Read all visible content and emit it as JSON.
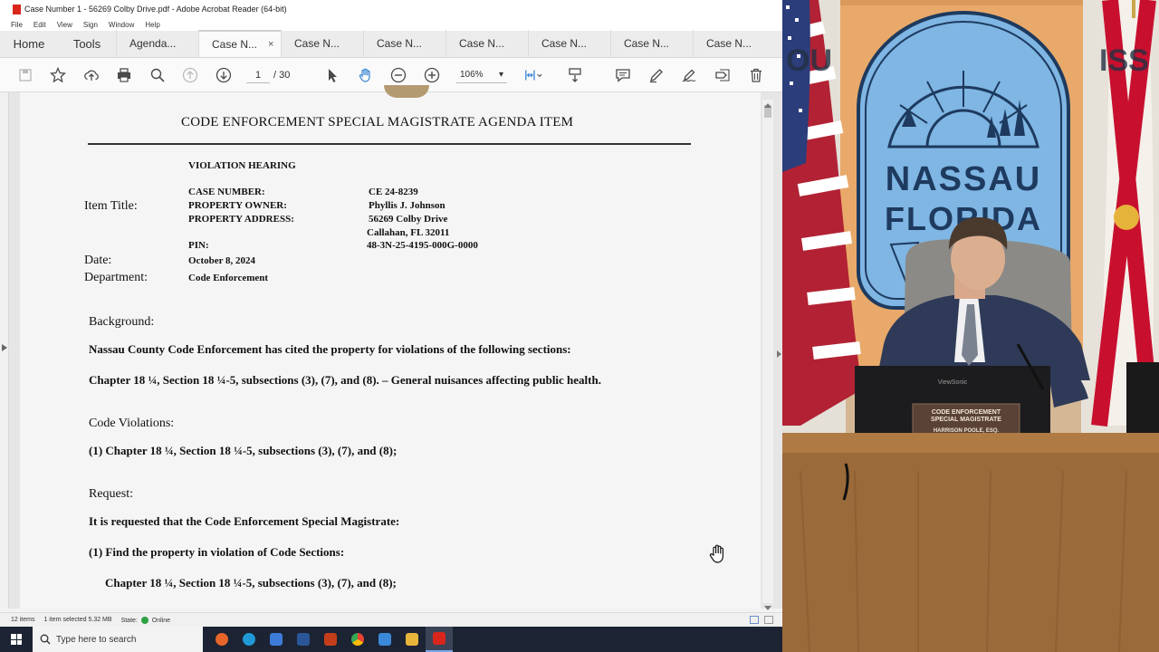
{
  "window": {
    "title": "Case Number 1 - 56269 Colby Drive.pdf - Adobe Acrobat Reader (64-bit)",
    "menu": [
      "File",
      "Edit",
      "View",
      "Sign",
      "Window",
      "Help"
    ]
  },
  "tabs": {
    "home": "Home",
    "tools": "Tools",
    "docs": [
      "Agenda...",
      "Case N...",
      "Case N...",
      "Case N...",
      "Case N...",
      "Case N...",
      "Case N...",
      "Case N..."
    ],
    "active_index": 1,
    "close_symbol": "×"
  },
  "toolbar": {
    "page_current": "1",
    "page_total": "/ 30",
    "zoom": "106%",
    "zoom_caret": "▾"
  },
  "document": {
    "heading": "CODE ENFORCEMENT SPECIAL MAGISTRATE AGENDA ITEM",
    "hearing_type": "VIOLATION HEARING",
    "labels": {
      "item_title": "Item Title:",
      "date": "Date:",
      "department": "Department:"
    },
    "fields": {
      "case_number_label": "CASE NUMBER:",
      "case_number": "CE 24-8239",
      "owner_label": "PROPERTY OWNER:",
      "owner": "Phyllis J. Johnson",
      "address_label": "PROPERTY ADDRESS:",
      "address_line1": "56269 Colby Drive",
      "address_line2": "Callahan, FL 32011",
      "pin_label": "PIN:",
      "pin": "48-3N-25-4195-000G-0000",
      "date": "October 8, 2024",
      "department": "Code Enforcement"
    },
    "background_label": "Background:",
    "background_text": "Nassau County Code Enforcement has cited the property for violations of the following sections:",
    "background_chapter": "Chapter 18 ¼, Section 18 ¼-5, subsections (3), (7), and (8). – General nuisances affecting public health.",
    "violations_label": "Code Violations:",
    "violation_1": "(1)  Chapter 18 ¼, Section 18 ¼-5, subsections (3), (7), and (8);",
    "request_label": "Request:",
    "request_text": "It is requested that the Code Enforcement Special Magistrate:",
    "request_1": "(1) Find the property in violation of Code Sections:",
    "request_1_chapter": "Chapter 18 ¼, Section 18 ¼-5, subsections (3), (7), and (8);"
  },
  "status": {
    "items": "12 items",
    "selected": "1 item selected  5.32 MB",
    "state_label": "State:",
    "state_value": "Online"
  },
  "taskbar": {
    "search_placeholder": "Type here to search",
    "apps": [
      {
        "icon": "firefox-icon",
        "color": "#e8662a"
      },
      {
        "icon": "edge-icon",
        "color": "#1f9ad6"
      },
      {
        "icon": "file-explorer-icon",
        "color": "#3d7bd8"
      },
      {
        "icon": "word-icon",
        "color": "#2b579a"
      },
      {
        "icon": "powerpoint-icon",
        "color": "#c43e1c"
      },
      {
        "icon": "chrome-icon",
        "color": "#34a853"
      },
      {
        "icon": "photos-icon",
        "color": "#3b8ad9"
      },
      {
        "icon": "folder-icon",
        "color": "#e8b53b"
      },
      {
        "icon": "acrobat-icon",
        "color": "#d9261c"
      }
    ]
  },
  "video": {
    "banner_line1": "NASSAU",
    "banner_line2": "FLORIDA",
    "wall_text_left": "OU",
    "wall_text_right": "ISS",
    "nameplate_line1": "CODE ENFORCEMENT",
    "nameplate_line2": "SPECIAL MAGISTRATE",
    "nameplate_line3": "HARRISON POOLE, ESQ.",
    "monitor_brand": "ViewSonic"
  },
  "colors": {
    "acrobat_red": "#d9261c",
    "banner_blue": "#7fb6e3",
    "banner_orange": "#e9a96a",
    "podium_wood": "#9a6a3a"
  }
}
